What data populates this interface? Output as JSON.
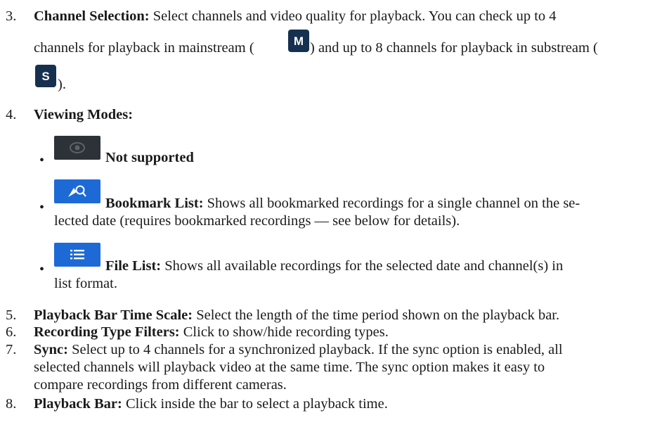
{
  "item3": {
    "number": "3.",
    "label": "Channel Selection:",
    "line1": "Select channels and video quality for playback. You can check up to 4",
    "line2a": "channels for playback in mainstream (",
    "mainstream_badge": "M",
    "line2b": ") and up to 8 channels for playback in substream (",
    "substream_badge": "S",
    "line3": ")."
  },
  "item4": {
    "number": "4.",
    "label": "Viewing Modes:",
    "modes": [
      {
        "icon": "eye-icon",
        "label": "Not supported",
        "text": ""
      },
      {
        "icon": "bookmark-search-icon",
        "label": "Bookmark List:",
        "text": "Shows all bookmarked recordings for a single channel on the se-",
        "text2": "lected date (requires bookmarked recordings — see below for details)."
      },
      {
        "icon": "list-icon",
        "label": "File List:",
        "text": "Shows all available recordings for the selected date and channel(s) in",
        "text2": "list format."
      }
    ]
  },
  "item5": {
    "number": "5.",
    "label": "Playback Bar Time Scale:",
    "text": "Select the length of the time period shown on the playback bar."
  },
  "item6": {
    "number": "6.",
    "label": "Recording Type Filters:",
    "text": "Click to show/hide recording types."
  },
  "item7": {
    "number": "7.",
    "label": "Sync:",
    "text": "Select up to 4 channels for a synchronized playback. If the sync option is enabled, all",
    "text2": "selected channels will playback video at the same time. The sync option makes it easy to",
    "text3": "compare recordings from different cameras."
  },
  "item8": {
    "number": "8.",
    "label": "Playback Bar:",
    "text": "Click inside the bar to select a playback time."
  },
  "colors": {
    "badge": "#16304f",
    "icon_dark": "#2d3238",
    "icon_blue": "#1d6ad6"
  }
}
